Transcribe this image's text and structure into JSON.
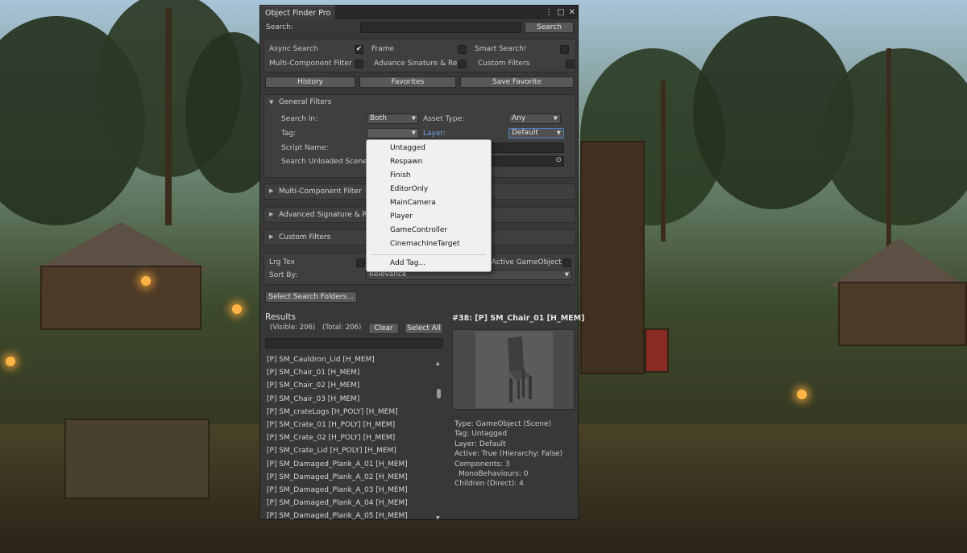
{
  "window": {
    "title": "Object Finder Pro",
    "menu_icon": "kebab-menu-icon",
    "maximize_icon": "maximize-icon",
    "close_icon": "close-icon"
  },
  "search": {
    "label": "Search:",
    "value": "",
    "button": "Search"
  },
  "options": {
    "async_search": {
      "label": "Async Search",
      "checked": true
    },
    "frame": {
      "label": "Frame",
      "checked": false
    },
    "smart_search": {
      "label": "Smart Search",
      "help_icon": "help-icon",
      "checked": false
    },
    "multi_component_filter": {
      "label": "Multi-Component Filter",
      "checked": false
    },
    "advance_signature": {
      "label": "Advance Sinature & Ref",
      "checked": false
    },
    "custom_filters": {
      "label": "Custom Filters",
      "checked": false
    }
  },
  "actions": {
    "history": "History",
    "favorites": "Favorites",
    "save_favorite": "Save Favorite"
  },
  "general_filters": {
    "header": "General Filters",
    "search_in_label": "Search In:",
    "search_in_value": "Both",
    "asset_type_label": "Asset Type:",
    "asset_type_value": "Any",
    "tag_label": "Tag:",
    "tag_value": "",
    "layer_label": "Layer:",
    "layer_value": "Default",
    "script_name_label": "Script Name:",
    "search_unloaded_label": "Search Unloaded Scene"
  },
  "sections": {
    "multi_component": "Multi-Component Filter",
    "advanced_signature": "Advanced Signature & Re",
    "custom_filters": "Custom Filters"
  },
  "misc": {
    "lrg_tex": "Lrg Tex",
    "active_gameobject": "Active GameObject",
    "sort_by_label": "Sort By:",
    "sort_by_value": "Relevance",
    "select_folders": "Select Search Folders..."
  },
  "results": {
    "title": "Results",
    "visible": "(Visible: 206)",
    "total": "(Total: 206)",
    "clear": "Clear",
    "select_all": "Select All",
    "items": [
      "[P] SM_Cauldron_Lid [H_MEM]",
      "[P] SM_Chair_01 [H_MEM]",
      "[P] SM_Chair_02 [H_MEM]",
      "[P] SM_Chair_03 [H_MEM]",
      "[P] SM_crateLogs [H_POLY] [H_MEM]",
      "[P] SM_Crate_01 [H_POLY] [H_MEM]",
      "[P] SM_Crate_02 [H_POLY] [H_MEM]",
      "[P] SM_Crate_Lid [H_POLY] [H_MEM]",
      "[P] SM_Damaged_Plank_A_01 [H_MEM]",
      "[P] SM_Damaged_Plank_A_02 [H_MEM]",
      "[P] SM_Damaged_Plank_A_03 [H_MEM]",
      "[P] SM_Damaged_Plank_A_04 [H_MEM]",
      "[P] SM_Damaged_Plank_A_05 [H_MEM]"
    ]
  },
  "details": {
    "title": "#38: [P] SM_Chair_01 [H_MEM]",
    "type": "Type: GameObject (Scene)",
    "tag": "Tag: Untagged",
    "layer": "Layer: Default",
    "active": "Active: True (Hierarchy: False)",
    "components": "Components: 3",
    "mono": "MonoBehaviours: 0",
    "children": "Children (Direct): 4"
  },
  "tag_menu": {
    "items": [
      "Untagged",
      "Respawn",
      "Finish",
      "EditorOnly",
      "MainCamera",
      "Player",
      "GameController",
      "CinemachineTarget"
    ],
    "add_tag": "Add Tag..."
  }
}
